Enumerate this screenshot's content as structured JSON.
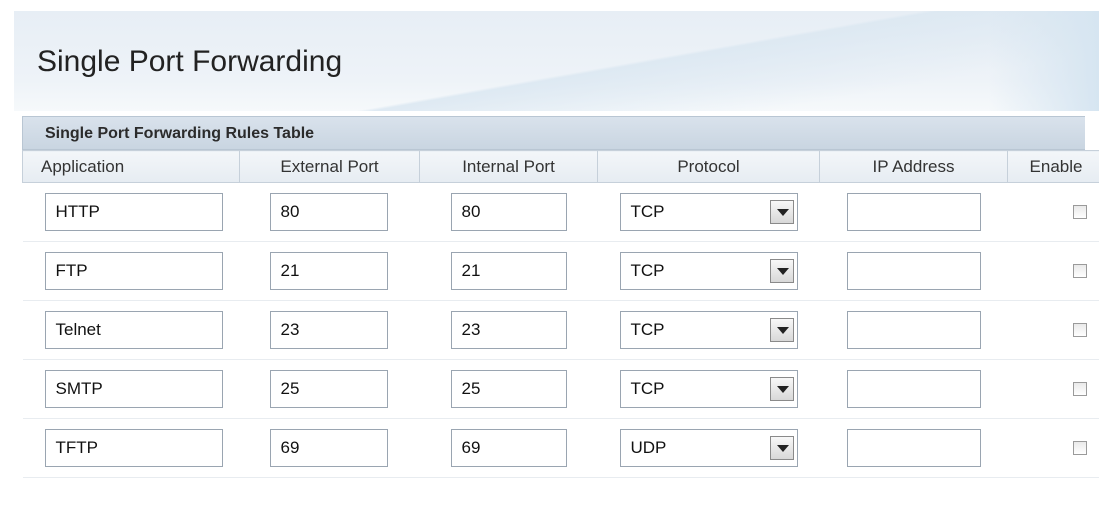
{
  "page_title": "Single Port Forwarding",
  "table": {
    "caption": "Single Port Forwarding Rules Table",
    "headers": [
      "Application",
      "External Port",
      "Internal Port",
      "Protocol",
      "IP Address",
      "Enable"
    ],
    "rows": [
      {
        "application": "HTTP",
        "external_port": "80",
        "internal_port": "80",
        "protocol": "TCP",
        "ip_address": "",
        "enabled": false
      },
      {
        "application": "FTP",
        "external_port": "21",
        "internal_port": "21",
        "protocol": "TCP",
        "ip_address": "",
        "enabled": false
      },
      {
        "application": "Telnet",
        "external_port": "23",
        "internal_port": "23",
        "protocol": "TCP",
        "ip_address": "",
        "enabled": false
      },
      {
        "application": "SMTP",
        "external_port": "25",
        "internal_port": "25",
        "protocol": "TCP",
        "ip_address": "",
        "enabled": false
      },
      {
        "application": "TFTP",
        "external_port": "69",
        "internal_port": "69",
        "protocol": "UDP",
        "ip_address": "",
        "enabled": false
      }
    ]
  },
  "icons": {
    "dropdown": "chevron-down-icon",
    "checkbox": "checkbox-unchecked"
  }
}
